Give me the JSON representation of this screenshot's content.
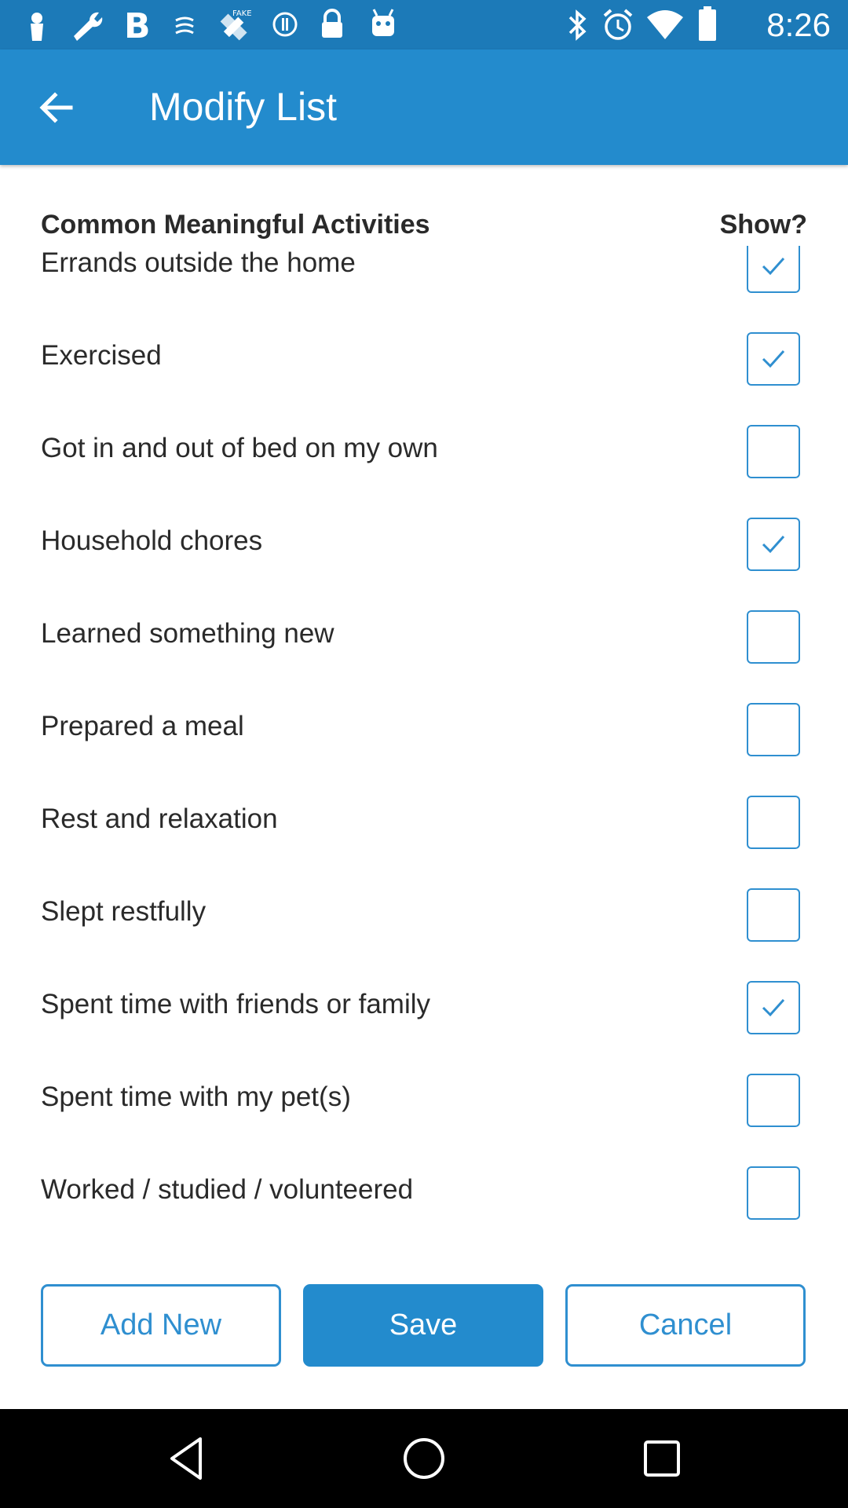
{
  "status_bar": {
    "time": "8:26",
    "left_icons": [
      "notification-icon",
      "wrench-icon",
      "bold-b-icon",
      "swipe-icon",
      "fake-gps-icon",
      "circle-info-icon",
      "lock-icon",
      "android-icon"
    ],
    "right_icons": [
      "bluetooth-icon",
      "alarm-icon",
      "wifi-icon",
      "battery-icon"
    ]
  },
  "app_bar": {
    "title": "Modify List",
    "back_icon": "arrow-left-icon"
  },
  "list": {
    "header_label": "Common Meaningful Activities",
    "header_show": "Show?",
    "items": [
      {
        "label": "Errands outside the home",
        "checked": true
      },
      {
        "label": "Exercised",
        "checked": true
      },
      {
        "label": "Got in and out of bed on my own",
        "checked": false
      },
      {
        "label": "Household chores",
        "checked": true
      },
      {
        "label": "Learned something new",
        "checked": false
      },
      {
        "label": "Prepared a meal",
        "checked": false
      },
      {
        "label": "Rest and relaxation",
        "checked": false
      },
      {
        "label": "Slept restfully",
        "checked": false
      },
      {
        "label": "Spent time with friends or family",
        "checked": true
      },
      {
        "label": "Spent time with my pet(s)",
        "checked": false
      },
      {
        "label": "Worked / studied / volunteered",
        "checked": false
      }
    ]
  },
  "buttons": {
    "add_new": "Add New",
    "save": "Save",
    "cancel": "Cancel"
  },
  "colors": {
    "status_bar": "#1c7ab8",
    "app_bar": "#238bcd",
    "accent": "#2f8fd0"
  },
  "nav_bar": {
    "icons": [
      "back-triangle-icon",
      "home-circle-icon",
      "recents-square-icon"
    ]
  }
}
